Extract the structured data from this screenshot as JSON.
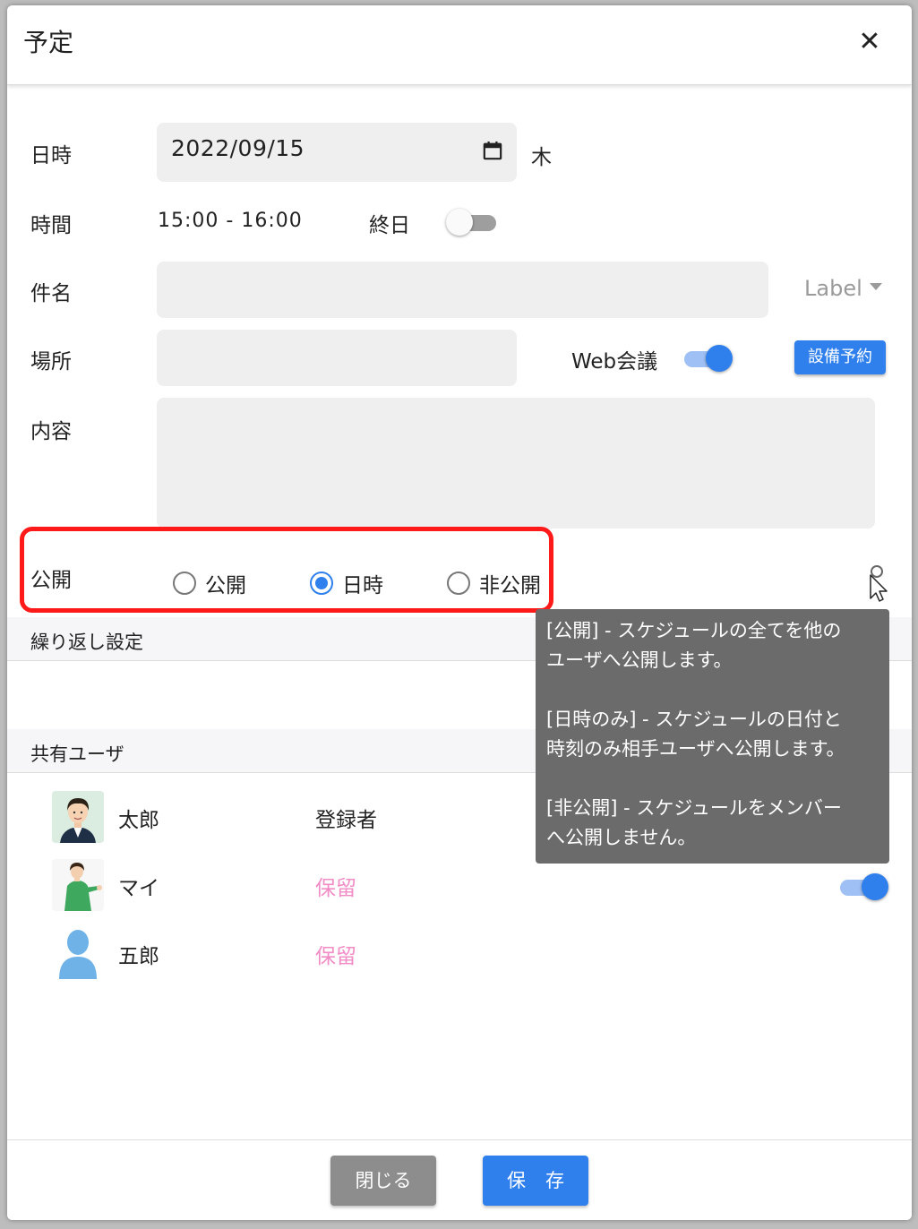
{
  "dialog": {
    "title": "予定",
    "close_glyph": "✕"
  },
  "form": {
    "date_label": "日時",
    "date_value": "2022/09/15",
    "weekday": "木",
    "time_label": "時間",
    "time_value": "15:00 - 16:00",
    "allday_label": "終日",
    "allday_on": false,
    "subject_label": "件名",
    "subject_value": "",
    "label_select": "Label",
    "place_label": "場所",
    "place_value": "",
    "webmeeting_label": "Web会議",
    "webmeeting_on": true,
    "facility_button": "設備予約",
    "content_label": "内容",
    "content_value": "",
    "visibility_label": "公開",
    "visibility_options": [
      "公開",
      "日時",
      "非公開"
    ],
    "visibility_selected": "日時"
  },
  "sections": {
    "repeat": "繰り返し設定",
    "shared": "共有ユーザ"
  },
  "users": [
    {
      "name": "太郎",
      "status": "登録者",
      "status_color": "#222222"
    },
    {
      "name": "マイ",
      "status": "保留",
      "status_color": "#f28cc6",
      "toggle_on": true
    },
    {
      "name": "五郎",
      "status": "保留",
      "status_color": "#f28cc6"
    }
  ],
  "tooltip": {
    "line1": "[公開] - スケジュールの全てを他の",
    "line2": "ユーザへ公開します。",
    "line3": "[日時のみ] - スケジュールの日付と",
    "line4": "時刻のみ相手ユーザへ公開します。",
    "line5": "[非公開] - スケジュールをメンバー",
    "line6": "へ公開しません。"
  },
  "footer": {
    "close_label": "閉じる",
    "save_label": "保存"
  },
  "colors": {
    "accent": "#2f80ed",
    "highlight": "#ff1a1a",
    "pending": "#f28cc6"
  }
}
